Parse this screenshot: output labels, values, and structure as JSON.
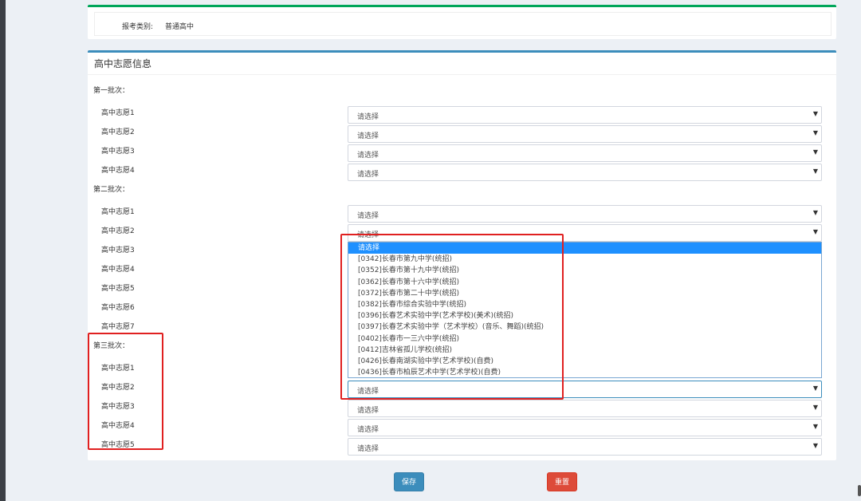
{
  "exam_type": {
    "label": "报考类别:",
    "value": "普通高中"
  },
  "section_title": "高中志愿信息",
  "batches": [
    {
      "label": "第一批次：",
      "wishes": [
        "高中志愿1",
        "高中志愿2",
        "高中志愿3",
        "高中志愿4"
      ]
    },
    {
      "label": "第二批次：",
      "wishes": [
        "高中志愿1",
        "高中志愿2",
        "高中志愿3",
        "高中志愿4",
        "高中志愿5",
        "高中志愿6",
        "高中志愿7"
      ]
    },
    {
      "label": "第三批次：",
      "wishes": [
        "高中志愿1",
        "高中志愿2",
        "高中志愿3",
        "高中志愿4",
        "高中志愿5"
      ]
    }
  ],
  "select_placeholder": "请选择",
  "dropdown_options": [
    "请选择",
    "[0342]长春市第九中学(统招)",
    "[0352]长春市第十九中学(统招)",
    "[0362]长春市第十六中学(统招)",
    "[0372]长春市第二十中学(统招)",
    "[0382]长春市综合实验中学(统招)",
    "[0396]长春艺术实验中学(艺术学校)(美术)(统招)",
    "[0397]长春艺术实验中学（艺术学校）(音乐、舞蹈)(统招)",
    "[0402]长春市一三六中学(统招)",
    "[0412]吉林省孤儿学校(统招)",
    "[0426]长春南湖实验中学(艺术学校)(自费)",
    "[0436]长春市柏辰艺术中学(艺术学校)(自费)"
  ],
  "buttons": {
    "save": "保存",
    "reset": "重置"
  },
  "colors": {
    "save": "#3c8dbc",
    "reset": "#dd4b39",
    "highlight": "#e02020",
    "accent_green": "#00a65a"
  }
}
